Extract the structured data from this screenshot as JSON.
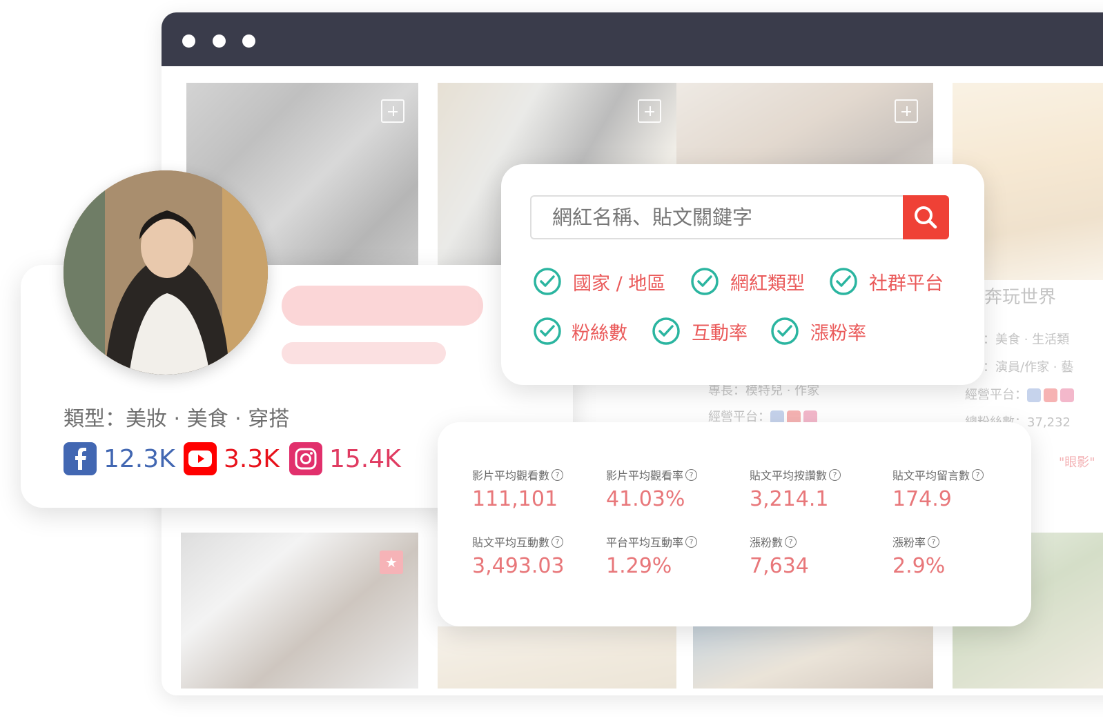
{
  "browser": {
    "window_dots": [
      "close",
      "minimize",
      "maximize"
    ]
  },
  "background_cards": {
    "title_partial": "奔玩世界",
    "type_partial": "型：美食 · 生活類",
    "skill_partial": "長：演員/作家 · 藝",
    "platform_label": "經營平台：",
    "platform_label_2": "經營平台：",
    "skill_partial_2": "專長：模特兒 · 作家",
    "followers_partial": "總粉絲數：37,232",
    "tag_partial": "\"眼影\""
  },
  "profile": {
    "type_line": "類型：美妝 · 美食 · 穿搭",
    "facebook_count": "12.3K",
    "youtube_count": "3.3K",
    "instagram_count": "15.4K"
  },
  "search": {
    "placeholder": "網紅名稱、貼文關鍵字",
    "filters": [
      "國家 / 地區",
      "網紅類型",
      "社群平台",
      "粉絲數",
      "互動率",
      "漲粉率"
    ]
  },
  "stats": {
    "items": [
      {
        "label": "影片平均觀看數",
        "value": "111,101"
      },
      {
        "label": "影片平均觀看率",
        "value": "41.03%"
      },
      {
        "label": "貼文平均按讚數",
        "value": "3,214.1"
      },
      {
        "label": "貼文平均留言數",
        "value": "174.9"
      },
      {
        "label": "貼文平均互動數",
        "value": "3,493.03"
      },
      {
        "label": "平台平均互動率",
        "value": "1.29%"
      },
      {
        "label": "漲粉數",
        "value": "7,634"
      },
      {
        "label": "漲粉率",
        "value": "2.9%"
      }
    ]
  },
  "colors": {
    "accent_red": "#ef4136",
    "value_pink": "#e8777a",
    "check_teal": "#2bb5a0",
    "facebook": "#4267b2",
    "youtube": "#ff0000",
    "instagram": "#e1306c",
    "titlebar": "#3a3c4b"
  },
  "icons": {
    "search": "search-icon",
    "check": "check-circle-icon",
    "help": "question-circle-icon",
    "add": "add-to-list-icon",
    "star": "star-icon"
  }
}
